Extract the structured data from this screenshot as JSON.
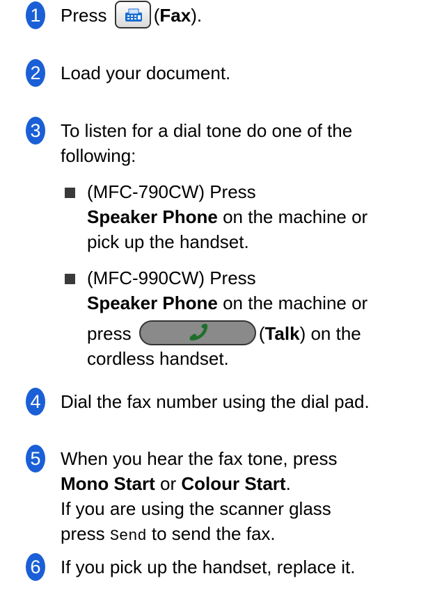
{
  "steps": [
    {
      "number": "1",
      "before": "Press",
      "icon": "fax-icon",
      "paren_open": "(",
      "bold": "Fax",
      "paren_close": ")."
    },
    {
      "number": "2",
      "text": "Load your document."
    },
    {
      "number": "3",
      "line1": "To listen for a dial tone do one of the",
      "line2": "following:"
    },
    {
      "number": "4",
      "text": "Dial the fax number using the dial pad."
    },
    {
      "number": "5",
      "line1": "When you hear the fax tone, press",
      "bold1": "Mono Start",
      "or": " or ",
      "bold2": "Colour Start",
      "period": ".",
      "line3": "If you are using the scanner glass",
      "line4a": "press ",
      "mono": "Send",
      "line4b": " to send the fax."
    },
    {
      "number": "6",
      "text": "If you pick up the handset, replace it."
    }
  ],
  "bullets": [
    {
      "line1": "(MFC-790CW) Press",
      "bold": "Speaker Phone",
      "line2_rest": " on the machine or",
      "line3": "pick up the handset."
    },
    {
      "line1": "(MFC-990CW) Press",
      "bold": "Speaker Phone",
      "line2_rest": " on the machine or",
      "press": "press",
      "icon": "talk-icon",
      "paren_open": "(",
      "talk": "Talk",
      "paren_rest": ") on the",
      "line4": "cordless handset."
    }
  ],
  "colors": {
    "step_number_bg": "#1a5fd6",
    "talk_button": "#8a8a8a",
    "talk_handset": "#1f6f2a"
  }
}
